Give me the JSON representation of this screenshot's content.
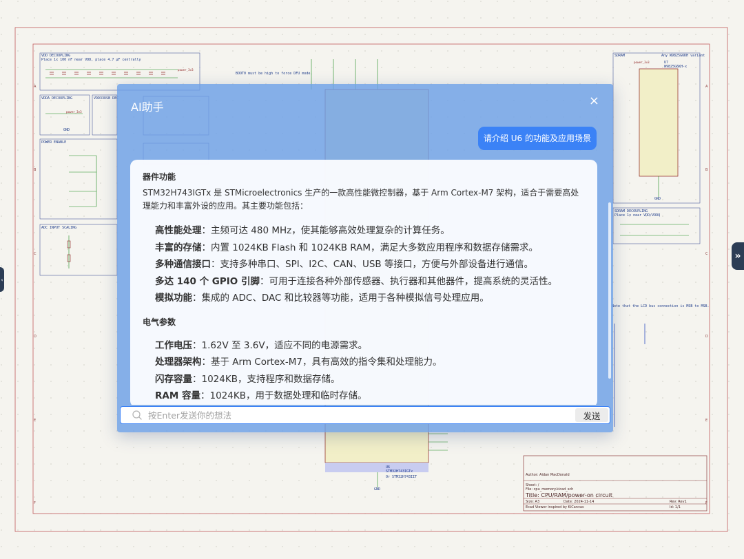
{
  "dialog": {
    "title": "AI助手",
    "close_label": "×",
    "user_message": "请介绍 U6 的功能及应用场景",
    "response": {
      "section1_heading": "器件功能",
      "intro": "STM32H743IGTx 是 STMicroelectronics 生产的一款高性能微控制器，基于 Arm Cortex-M7 架构，适合于需要高处理能力和丰富外设的应用。其主要功能包括：",
      "features": [
        {
          "key": "高性能处理",
          "text": "：主频可达 480 MHz，使其能够高效处理复杂的计算任务。"
        },
        {
          "key": "丰富的存储",
          "text": "：内置 1024KB Flash 和 1024KB RAM，满足大多数应用程序和数据存储需求。"
        },
        {
          "key": "多种通信接口",
          "text": "：支持多种串口、SPI、I2C、CAN、USB 等接口，方便与外部设备进行通信。"
        },
        {
          "key": "多达 140 个 GPIO 引脚",
          "text": "：可用于连接各种外部传感器、执行器和其他器件，提高系统的灵活性。"
        },
        {
          "key": "模拟功能",
          "text": "：集成的 ADC、DAC 和比较器等功能，适用于各种模拟信号处理应用。"
        }
      ],
      "section2_heading": "电气参数",
      "params": [
        {
          "key": "工作电压",
          "text": "：1.62V 至 3.6V，适应不同的电源需求。"
        },
        {
          "key": "处理器架构",
          "text": "：基于 Arm Cortex-M7，具有高效的指令集和处理能力。"
        },
        {
          "key": "闪存容量",
          "text": "：1024KB，支持程序和数据存储。"
        },
        {
          "key": "RAM 容量",
          "text": "：1024KB，用于数据处理和临时存储。"
        }
      ]
    },
    "input": {
      "placeholder": "按Enter发送你的想法",
      "value": "",
      "send_label": "发送"
    }
  },
  "schematic": {
    "blocks": {
      "vdd_decoupling": "VDD DECOUPLING",
      "vdd_note": "Place 1x 100 nF near VDD, place 4.7 µF centrally",
      "vdda_decoupling": "VDDA DECOUPLING",
      "vdd33usb": "VDD33USB DEC",
      "power_enable": "POWER ENABLE",
      "adc_scaling": "ADC INPUT SCALING",
      "sdram": "SDRAM",
      "sdram_variant": "Any W9825G6KH variant",
      "sdram_decoupling": "SDRAM DECOUPLING",
      "sdram_dec_note": "Place 1x near VDD/VDDQ",
      "boot_note": "BOOT0 must be high to force DFU mode.",
      "lcd_note": "Note that the LCD bus connection is MSB to MSB."
    },
    "labels": {
      "power_3v3": "power_3v3",
      "gnd": "GND",
      "u6_ref": "U6",
      "u6_part": "STM32H743IGTx",
      "u6_alt": "Or STM32H743IIT",
      "u7_ref": "U7",
      "u7_part": "W9825G6KH-x"
    },
    "title_block": {
      "author": "Author: Aidan MacDonald",
      "sheet": "Sheet: /",
      "file": "File: cpu_memory.kicad_sch",
      "title": "Title: CPU/RAM/power-on circuit",
      "size": "Size: A3",
      "date": "Date: 2024-11-14",
      "rev": "Rev: Rev1",
      "viewer": "Ecad Viewer inspired by KiCanvas",
      "id": "Id: 1/1"
    },
    "border_rows": [
      "A",
      "B",
      "C",
      "D",
      "E",
      "F"
    ]
  },
  "handles": {
    "right_label": "»",
    "left_label": "‹"
  },
  "colors": {
    "dialog_bg": "#6ca0e6",
    "user_bubble": "#3b82f6",
    "sheet_border": "#b03a3a",
    "wire": "#1a8a1a",
    "component": "#8b1d1d"
  }
}
